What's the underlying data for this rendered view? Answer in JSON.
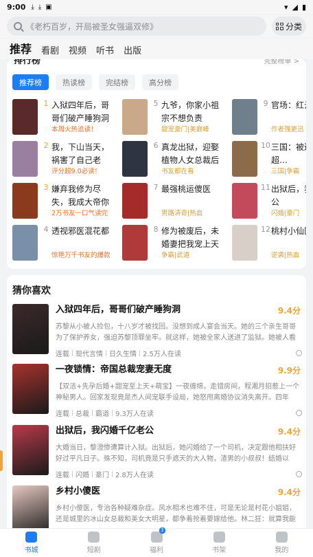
{
  "status": {
    "time": "9:00",
    "icons": [
      "download-icon",
      "download-icon",
      "app-icon"
    ],
    "right_icons": [
      "wifi-icon",
      "signal-icon",
      "battery-icon"
    ]
  },
  "search": {
    "placeholder": "《老朽百岁，开局被圣女强逼双修》"
  },
  "category_button": {
    "label": "分类"
  },
  "main_tabs": [
    {
      "label": "推荐",
      "active": true
    },
    {
      "label": "看剧"
    },
    {
      "label": "视频"
    },
    {
      "label": "听书"
    },
    {
      "label": "出版"
    }
  ],
  "ranking": {
    "title": "排行榜",
    "more": "完整榜单 >",
    "tabs": [
      {
        "label": "推荐榜",
        "active": true
      },
      {
        "label": "热读榜"
      },
      {
        "label": "完结榜"
      },
      {
        "label": "高分榜"
      }
    ],
    "items": [
      {
        "rank": "1",
        "name": "入狱四年后，哥哥们破产睡狗洞",
        "sub": "本周火热追读！",
        "sub_color": "#e8702a",
        "cover": "#5a2a2a"
      },
      {
        "rank": "2",
        "name": "我，下山当天，祸害了自己老婆！",
        "sub": "评分超9.0必读！",
        "sub_color": "#e8702a",
        "cover": "#9b7fa0"
      },
      {
        "rank": "3",
        "name": "嫌弃我修为尽失，我成大帝你哭啥",
        "sub": "2万书友一口气读完",
        "sub_color": "#e8702a",
        "cover": "#8a3b1e"
      },
      {
        "rank": "4",
        "name": "透视邪医混花都",
        "sub": "惊艳万千书友的爆款",
        "sub_color": "#e8702a",
        "cover": "#7a8fa8"
      },
      {
        "rank": "5",
        "name": "九爷，你家小祖宗不想负责",
        "sub": "甜宠豪门|美巅峰",
        "sub_color": "#d9a13a",
        "cover": "#c9a98a"
      },
      {
        "rank": "6",
        "name": "真龙出狱，迎娶植物人女总裁后我…",
        "sub": "书友都在看",
        "sub_color": "#d9a13a",
        "cover": "#2e3440"
      },
      {
        "rank": "7",
        "name": "最强桃运傻医",
        "sub": "男路清奇|热血",
        "sub_color": "#d9a13a",
        "cover": "#a52a2a"
      },
      {
        "rank": "8",
        "name": "修为被废后，未婚妻把我宠上天",
        "sub": "争霸|武道",
        "sub_color": "#d9a13a",
        "cover": "#b03a3a"
      },
      {
        "rank": "9",
        "name": "官场：红云志",
        "sub": "作者强更迅",
        "sub_color": "#d9a13a",
        "cover": "#6f7f8c"
      },
      {
        "rank": "10",
        "name": "三国：被迷，我超…",
        "sub": "三国|争霸",
        "sub_color": "#d9a13a",
        "cover": "#8c6b4a"
      },
      {
        "rank": "11",
        "name": "出狱后，我亿老公",
        "sub": "闪婚|豪门",
        "sub_color": "#d9a13a",
        "cover": "#c24a5a"
      },
      {
        "rank": "12",
        "name": "桃村小仙医",
        "sub": "逆袭|热血",
        "sub_color": "#d9a13a",
        "cover": "#d8d0c8"
      }
    ]
  },
  "guess": {
    "title": "猜你喜欢",
    "books": [
      {
        "title": "入狱四年后，哥哥们破产睡狗洞",
        "score": "9.4分",
        "desc": "苏黎从小被人捡包，十八岁才被找回。没想到成人宴会当天。她的三个亲生哥哥为了保护养女，强迫苏黎顶罪坐牢。就这样，她被全家人送进了监狱。她被人看打，被…",
        "tags": [
          "连载",
          "现代言情",
          "日久生情",
          "2.5万人在读"
        ],
        "cover": "#3c2a2a"
      },
      {
        "title": "一夜锁情：帝国总裁宠妻无度",
        "score": "9.9分",
        "desc": "【双洁+先孕后婚+甜宠至上天+萌宝】一夜缠绵，走错房间，程湘月招惹上一个神秘男人。回家发现竟是杰人间宠联手设局，她怒甩离婚协议消失离开。四年后，她携…",
        "tags": [
          "连载",
          "总裁",
          "霸道",
          "9.3万人在读"
        ],
        "cover": "#a8322e"
      },
      {
        "title": "出狱后，我闪婚千亿老公",
        "score": "9.4分",
        "desc": "大婚当日，黎澄惨遭算计入狱。出狱后，她闪婚给了一个司机，决定跟他相扶好好过平凡日子。殊不知，司机竟是只手遮天的大人物，渣男的小叔叔！结婚以后，劳…",
        "tags": [
          "连载",
          "闪婚",
          "豪门",
          "2.8万人在读"
        ],
        "cover": "#b83a4a"
      },
      {
        "title": "乡村小傻医",
        "score": "9.4分",
        "desc": "乡村小傻医，专治各种疑难杂症。风水相术也难不住，可是无论是村花小姐姐，还是城里的冰山女总裁和美女大明星，都争着抢着要嫁给他。林二狂：就算我能制服…",
        "tags": [
          "连载",
          "都市",
          "热血",
          "1.2万人在读"
        ],
        "cover": "#e6c8c0"
      }
    ]
  },
  "bottom_nav": [
    {
      "label": "书城",
      "active": true,
      "icon": "bookstore-icon"
    },
    {
      "label": "短剧",
      "icon": "video-icon"
    },
    {
      "label": "福利",
      "icon": "gift-icon",
      "badge": "3"
    },
    {
      "label": "书架",
      "icon": "bookshelf-icon"
    },
    {
      "label": "我的",
      "icon": "profile-icon"
    }
  ],
  "colors": {
    "accent": "#1e7df0",
    "score": "#f0a43a"
  }
}
